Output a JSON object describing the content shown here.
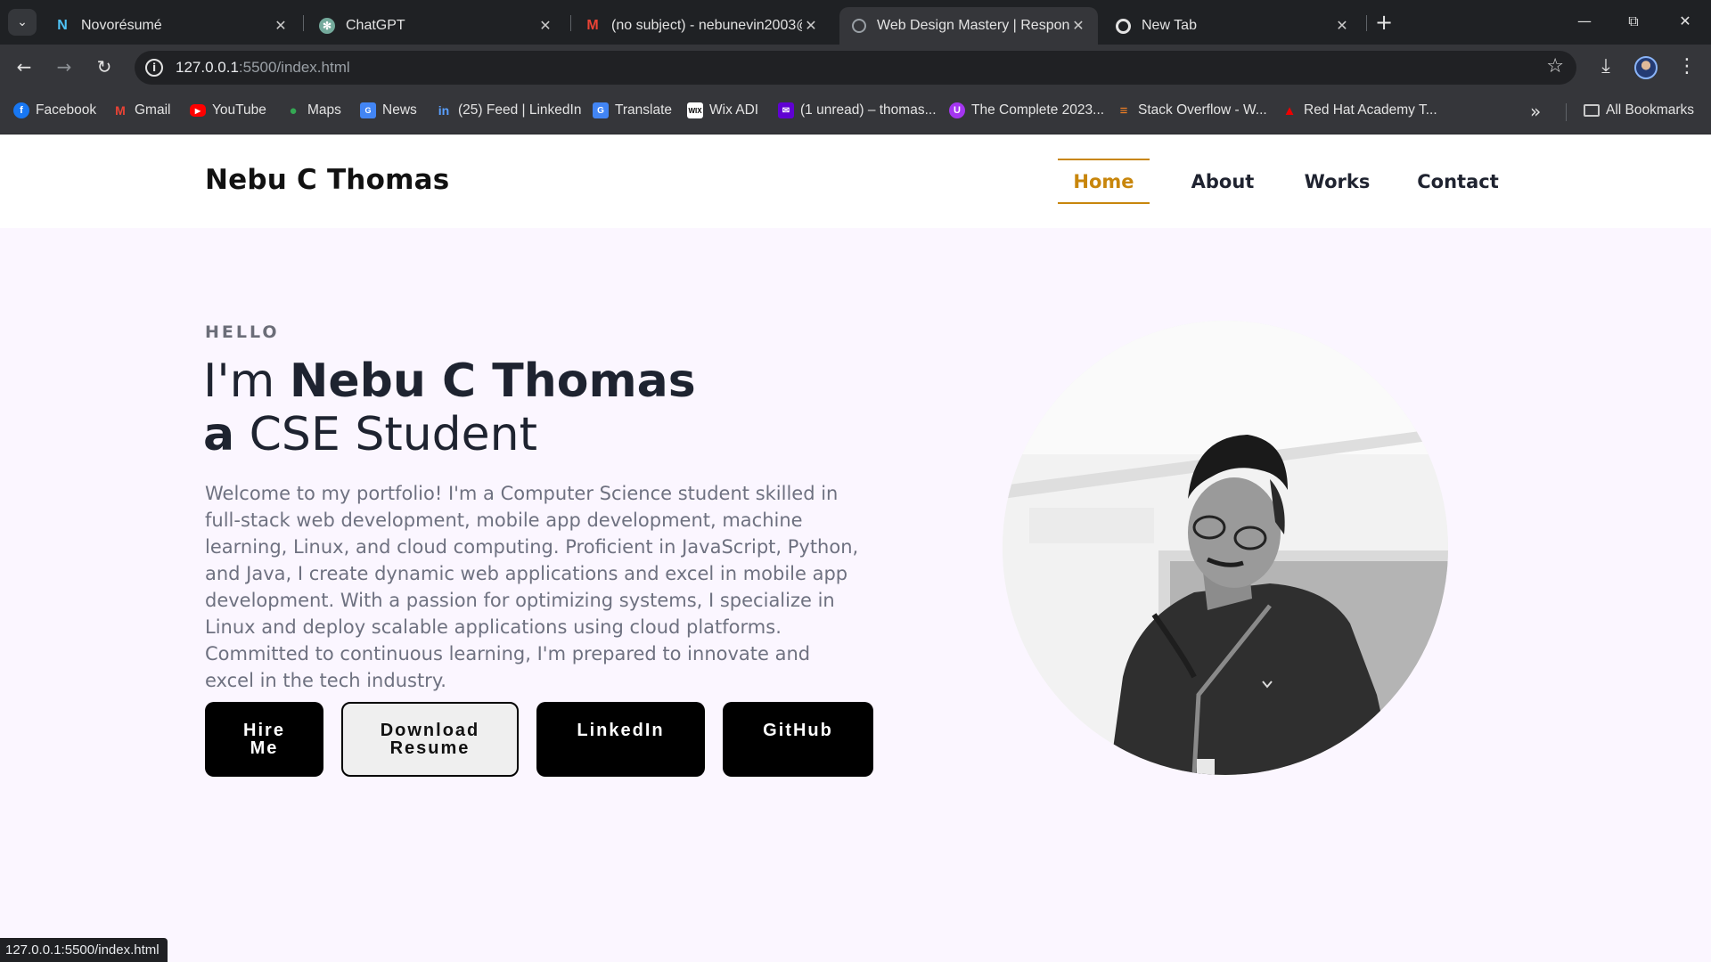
{
  "browser": {
    "tabs": [
      {
        "title": "Novorésumé",
        "icon": "novoresume-icon",
        "color": "#4fc3f7"
      },
      {
        "title": "ChatGPT",
        "icon": "chatgpt-icon",
        "color": "#74aa9c"
      },
      {
        "title": "(no subject) - nebunevin2003@",
        "icon": "gmail-icon",
        "color": "#ea4335"
      },
      {
        "title": "Web Design Mastery | Responsi",
        "icon": "globe-icon",
        "color": "#9aa0a6",
        "active": true
      },
      {
        "title": "New Tab",
        "icon": "chrome-icon",
        "color": "#e3e3e3"
      }
    ],
    "url_host": "127.0.0.1",
    "url_path": ":5500/index.html",
    "bookmarks": [
      {
        "label": "Facebook",
        "icon": "facebook-icon",
        "color": "#1877f2"
      },
      {
        "label": "Gmail",
        "icon": "gmail-icon",
        "color": "#ea4335"
      },
      {
        "label": "YouTube",
        "icon": "youtube-icon",
        "color": "#ff0000"
      },
      {
        "label": "Maps",
        "icon": "maps-icon",
        "color": "#34a853"
      },
      {
        "label": "News",
        "icon": "news-icon",
        "color": "#4285f4"
      },
      {
        "label": "(25) Feed | LinkedIn",
        "icon": "linkedin-icon",
        "color": "#0a66c2"
      },
      {
        "label": "Translate",
        "icon": "translate-icon",
        "color": "#4285f4"
      },
      {
        "label": "Wix ADI",
        "icon": "wix-icon",
        "color": "#ffffff"
      },
      {
        "label": "(1 unread) – thomas...",
        "icon": "yahoo-mail-icon",
        "color": "#6001d2"
      },
      {
        "label": "The Complete 2023...",
        "icon": "udemy-icon",
        "color": "#a435f0"
      },
      {
        "label": "Stack Overflow - W...",
        "icon": "stackoverflow-icon",
        "color": "#f48024"
      },
      {
        "label": "Red Hat Academy T...",
        "icon": "redhat-icon",
        "color": "#ee0000"
      }
    ],
    "all_bookmarks": "All Bookmarks",
    "status_url": "127.0.0.1:5500/index.html"
  },
  "site": {
    "logo": "Nebu C Thomas",
    "nav": [
      {
        "label": "Home",
        "active": true
      },
      {
        "label": "About"
      },
      {
        "label": "Works"
      },
      {
        "label": "Contact"
      }
    ],
    "accent_color": "#c8860c",
    "hero": {
      "greeting": "HELLO",
      "line1_prefix": "I'm ",
      "name": "Nebu C Thomas",
      "line2_prefix": "a",
      "role": " CSE Student",
      "description": "Welcome to my portfolio! I'm a Computer Science student skilled in full-stack web development, mobile app development, machine learning, Linux, and cloud computing. Proficient in JavaScript, Python, and Java, I create dynamic web applications and excel in mobile app development. With a passion for optimizing systems, I specialize in Linux and deploy scalable applications using cloud platforms. Committed to continuous learning, I'm prepared to innovate and excel in the tech industry.",
      "buttons": {
        "hire_line1": "Hire",
        "hire_line2": "Me",
        "download_line1": "Download",
        "download_line2": "Resume",
        "linkedin": "LinkedIn",
        "github": "GitHub"
      },
      "portrait_icon": "portrait-photo"
    }
  }
}
